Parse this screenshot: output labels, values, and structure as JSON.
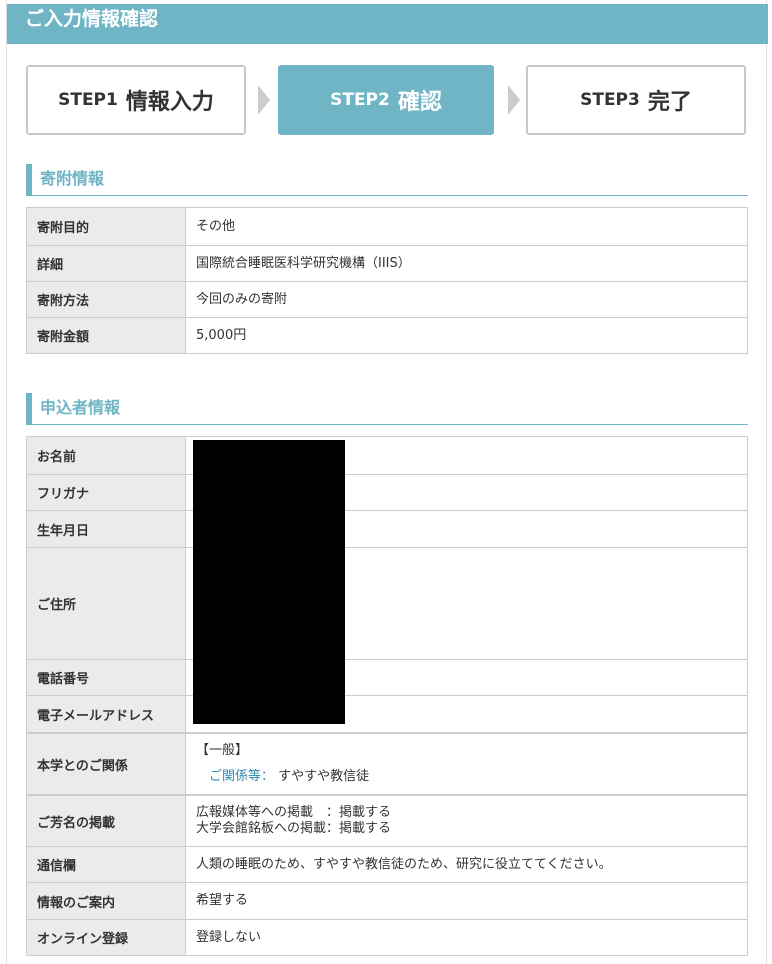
{
  "header": {
    "title": "ご入力情報確認"
  },
  "steps": [
    {
      "num": "STEP1",
      "name": "情報入力"
    },
    {
      "num": "STEP2",
      "name": "確認"
    },
    {
      "num": "STEP3",
      "name": "完了"
    }
  ],
  "donation": {
    "title": "寄附情報",
    "rows": [
      {
        "label": "寄附目的",
        "value": "その他"
      },
      {
        "label": "詳細",
        "value": "国際統合睡眠医科学研究機構（IIIS）"
      },
      {
        "label": "寄附方法",
        "value": "今回のみの寄附"
      },
      {
        "label": "寄附金額",
        "value": "5,000円"
      }
    ]
  },
  "applicant": {
    "title": "申込者情報",
    "rows": [
      {
        "label": "お名前",
        "value": ""
      },
      {
        "label": "フリガナ",
        "value": ""
      },
      {
        "label": "生年月日",
        "value": ""
      },
      {
        "label": "ご住所",
        "value": ""
      },
      {
        "label": "電話番号",
        "value": ""
      },
      {
        "label": "電子メールアドレス",
        "value": ""
      },
      {
        "label": "本学とのご関係",
        "value": "【一般】",
        "sub_label": "ご関係等：",
        "sub_value": "すやすや教信徒"
      },
      {
        "label": "ご芳名の掲載",
        "value_line1": "広報媒体等への掲載　：掲載する",
        "value_line2": "大学会館銘板への掲載：掲載する"
      },
      {
        "label": "通信欄",
        "value": "人類の睡眠のため、すやすや教信徒のため、研究に役立ててください。"
      },
      {
        "label": "情報のご案内",
        "value": "希望する"
      },
      {
        "label": "オンライン登録",
        "value": "登録しない"
      }
    ]
  },
  "colors": {
    "accent": "#6fb5c5",
    "label_bg": "#ebebeb",
    "border": "#cccccc",
    "link": "#2a8bb0"
  }
}
